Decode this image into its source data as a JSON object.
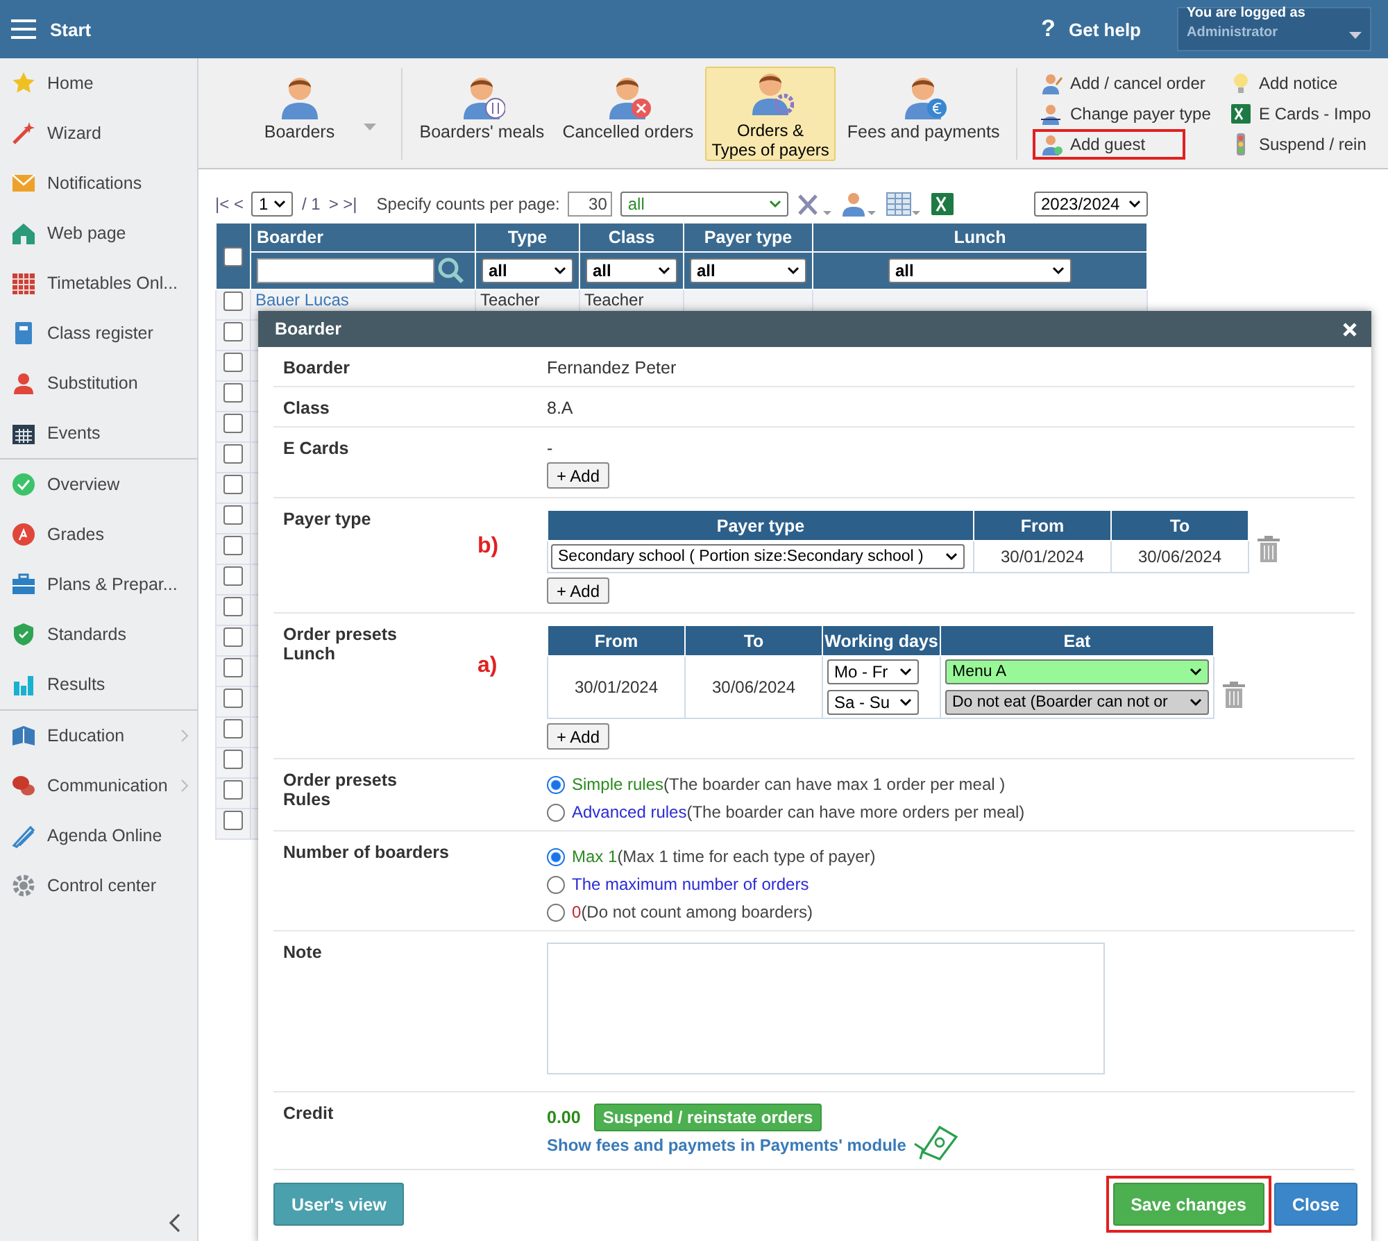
{
  "topbar": {
    "title": "Start",
    "help_icon": "?",
    "help": "Get help",
    "login_label": "You are logged as",
    "login_user": "Administrator"
  },
  "sidebar": {
    "groups": [
      [
        {
          "label": "Home",
          "submenu": false
        },
        {
          "label": "Wizard",
          "submenu": false
        },
        {
          "label": "Notifications",
          "submenu": false
        },
        {
          "label": "Web page",
          "submenu": false
        },
        {
          "label": "Timetables Onl...",
          "submenu": false
        },
        {
          "label": "Class register",
          "submenu": false
        },
        {
          "label": "Substitution",
          "submenu": false
        },
        {
          "label": "Events",
          "submenu": false
        }
      ],
      [
        {
          "label": "Overview",
          "submenu": false
        },
        {
          "label": "Grades",
          "submenu": false
        },
        {
          "label": "Plans & Prepar...",
          "submenu": false
        },
        {
          "label": "Standards",
          "submenu": false
        },
        {
          "label": "Results",
          "submenu": false
        }
      ],
      [
        {
          "label": "Education",
          "submenu": true
        },
        {
          "label": "Communication",
          "submenu": true
        },
        {
          "label": "Agenda Online",
          "submenu": false
        },
        {
          "label": "Control center",
          "submenu": false
        }
      ]
    ]
  },
  "toolbar": {
    "modules": [
      {
        "lines": [
          "Boarders"
        ],
        "selected": false,
        "dropdown": true
      },
      {
        "lines": [
          "Boarders' meals"
        ],
        "selected": false,
        "dropdown": false
      },
      {
        "lines": [
          "Cancelled orders"
        ],
        "selected": false,
        "dropdown": false
      },
      {
        "lines": [
          "Orders &",
          "Types of payers"
        ],
        "selected": true,
        "dropdown": false
      },
      {
        "lines": [
          "Fees and payments"
        ],
        "selected": false,
        "dropdown": false
      }
    ],
    "actions": [
      {
        "label": "Add / cancel order",
        "highlighted": false
      },
      {
        "label": "Change payer type",
        "highlighted": false
      },
      {
        "label": "Add guest",
        "highlighted": true
      },
      {
        "label": "Add notice",
        "highlighted": false
      },
      {
        "label": "E Cards - Impo",
        "highlighted": false
      },
      {
        "label": "Suspend / rein",
        "highlighted": false
      }
    ]
  },
  "list": {
    "pager": {
      "first_prev": "|< <",
      "page": "1",
      "total": "/ 1",
      "next_last": "> >|"
    },
    "counts_label": "Specify counts per page:",
    "counts": "30",
    "filter": "all",
    "year": "2023/2024",
    "all_checked": false,
    "columns": [
      {
        "title": "Boarder"
      },
      {
        "title": "Type",
        "filter": "all"
      },
      {
        "title": "Class",
        "filter": "all"
      },
      {
        "title": "Payer type",
        "filter": "all"
      },
      {
        "title": "Lunch",
        "filter": "all"
      }
    ],
    "rows": [
      {
        "checked": false,
        "cells": [
          "Bauer Lucas",
          "Teacher",
          "Teacher"
        ]
      },
      {
        "checked": false
      },
      {
        "checked": false
      },
      {
        "checked": false
      },
      {
        "checked": false
      },
      {
        "checked": false
      },
      {
        "checked": false
      },
      {
        "checked": false
      },
      {
        "checked": false
      },
      {
        "checked": false
      },
      {
        "checked": false
      },
      {
        "checked": false
      },
      {
        "checked": false
      },
      {
        "checked": false
      },
      {
        "checked": false
      },
      {
        "checked": false
      },
      {
        "checked": false
      },
      {
        "checked": false
      }
    ]
  },
  "dialog": {
    "title": "Boarder",
    "boarder": {
      "label": "Boarder",
      "value": "Fernandez Peter"
    },
    "class": {
      "label": "Class",
      "value": "8.A"
    },
    "e_cards": {
      "label": "E Cards",
      "value": "-",
      "add": "+ Add"
    },
    "payer_type": {
      "label": "Payer type",
      "marker": "b)",
      "columns": [
        "Payer type",
        "From",
        "To"
      ],
      "row": {
        "type": "Secondary school ( Portion size:Secondary school )",
        "from": "30/01/2024",
        "to": "30/06/2024"
      },
      "add": "+ Add"
    },
    "presets": {
      "label": [
        "Order presets",
        "Lunch"
      ],
      "marker": "a)",
      "columns": [
        "From",
        "To",
        "Working days",
        "Eat"
      ],
      "from": "30/01/2024",
      "to": "30/06/2024",
      "items": [
        {
          "days": "Mo - Fr",
          "eat": "Menu A",
          "kind": "menu"
        },
        {
          "days": "Sa - Su",
          "eat": "Do not eat (Boarder can not or",
          "kind": "none"
        }
      ],
      "add": "+ Add"
    },
    "rules": {
      "label": [
        "Order presets",
        "Rules"
      ],
      "options": [
        {
          "choice": "Simple rules",
          "note": "(The boarder can have max 1 order per meal )",
          "selected": true,
          "color": "#2b8a1f"
        },
        {
          "choice": "Advanced rules",
          "note": "(The boarder can have more orders per meal)",
          "selected": false,
          "color": "#2b2bd6"
        }
      ]
    },
    "count": {
      "label": "Number of boarders",
      "options": [
        {
          "choice": "Max 1",
          "note": "(Max 1 time for each type of payer)",
          "selected": true,
          "color": "#2b8a1f"
        },
        {
          "choice": "The maximum number of orders",
          "selected": false,
          "color": "#2b2bd6"
        },
        {
          "choice": "0",
          "note": "(Do not count among boarders)",
          "selected": false,
          "color": "#c0282d"
        }
      ]
    },
    "note": {
      "label": "Note"
    },
    "credit": {
      "label": "Credit",
      "amount": "0.00",
      "suspend": "Suspend / reinstate orders",
      "link": "Show fees and paymets in Payments' module"
    },
    "buttons": {
      "users_view": "User's view",
      "save": "Save changes",
      "save_highlighted": true,
      "close": "Close"
    }
  }
}
